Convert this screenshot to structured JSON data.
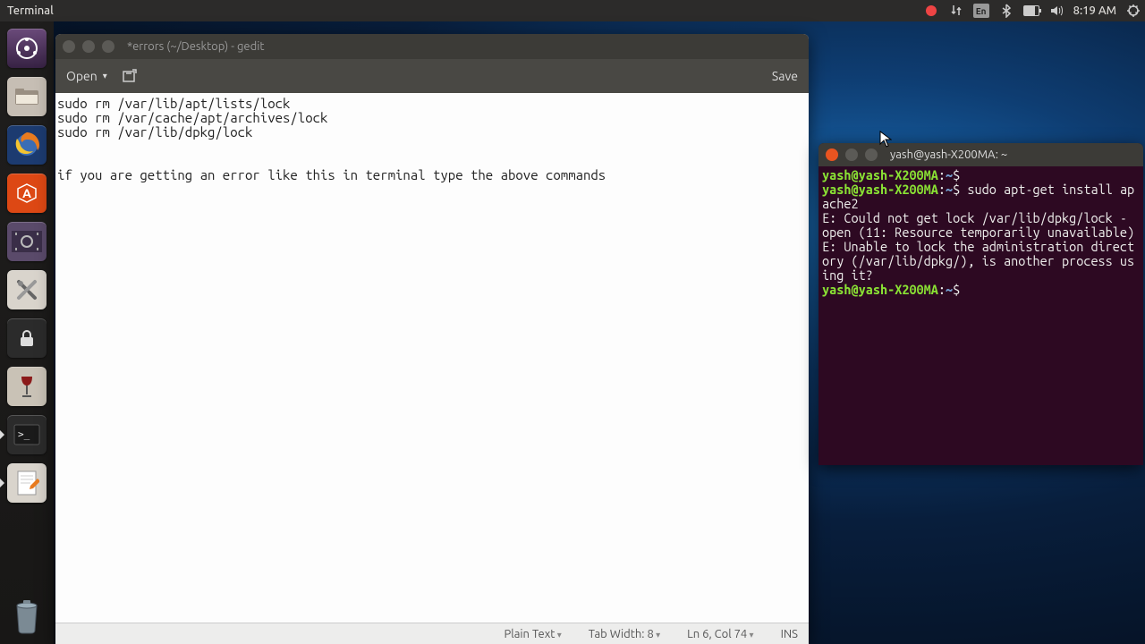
{
  "panel": {
    "app_label": "Terminal",
    "lang": "En",
    "clock": "8:19 AM"
  },
  "launcher": {
    "tips": [
      "dash",
      "files",
      "firefox",
      "software",
      "ubuntu-software",
      "videos",
      "settings",
      "lock",
      "search",
      "terminal",
      "gedit",
      "trash"
    ]
  },
  "gedit": {
    "title": "*errors (~/Desktop) - gedit",
    "open_label": "Open",
    "save_label": "Save",
    "content": "sudo rm /var/lib/apt/lists/lock\nsudo rm /var/cache/apt/archives/lock\nsudo rm /var/lib/dpkg/lock\n\n\nif you are getting an error like this in terminal type the above commands",
    "status": {
      "syntax": "Plain Text",
      "tabwidth": "Tab Width: 8",
      "position": "Ln 6, Col 74",
      "mode": "INS"
    }
  },
  "terminal": {
    "title": "yash@yash-X200MA: ~",
    "prompt_user": "yash@yash-X200MA",
    "prompt_sep": ":",
    "prompt_path": "~",
    "prompt_sym": "$",
    "cmd1": "",
    "cmd2": "sudo apt-get install apache2",
    "err1": "E: Could not get lock /var/lib/dpkg/lock - open (11: Resource temporarily unavailable)",
    "err2": "E: Unable to lock the administration directory (/var/lib/dpkg/), is another process using it?"
  }
}
